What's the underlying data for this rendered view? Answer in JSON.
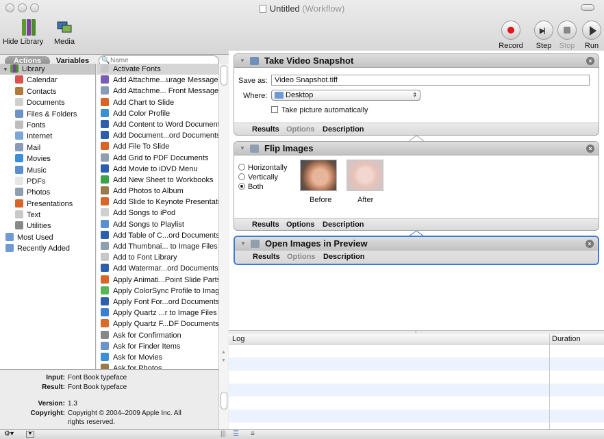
{
  "window": {
    "title": "Untitled",
    "subtitle": "(Workflow)"
  },
  "toolbar": {
    "hide_library": "Hide Library",
    "media": "Media",
    "record": "Record",
    "step": "Step",
    "stop": "Stop",
    "run": "Run"
  },
  "tabs": {
    "actions": "Actions",
    "variables": "Variables"
  },
  "search": {
    "placeholder": "Name"
  },
  "library": {
    "root": "Library",
    "items": [
      {
        "label": "Calendar",
        "icon": "calendar-icon",
        "color": "#d9534f"
      },
      {
        "label": "Contacts",
        "icon": "contacts-icon",
        "color": "#b07a3a"
      },
      {
        "label": "Documents",
        "icon": "documents-icon",
        "color": "#cfcfcf"
      },
      {
        "label": "Files & Folders",
        "icon": "folder-icon",
        "color": "#6b93c9"
      },
      {
        "label": "Fonts",
        "icon": "fonts-icon",
        "color": "#bdbdbd"
      },
      {
        "label": "Internet",
        "icon": "internet-icon",
        "color": "#7aa7d8"
      },
      {
        "label": "Mail",
        "icon": "mail-icon",
        "color": "#8a9bb8"
      },
      {
        "label": "Movies",
        "icon": "movies-icon",
        "color": "#3c8fd6"
      },
      {
        "label": "Music",
        "icon": "music-icon",
        "color": "#5a8fd0"
      },
      {
        "label": "PDFs",
        "icon": "pdf-icon",
        "color": "#e6e6e6"
      },
      {
        "label": "Photos",
        "icon": "photos-icon",
        "color": "#8f9fb0"
      },
      {
        "label": "Presentations",
        "icon": "presentations-icon",
        "color": "#d9642a"
      },
      {
        "label": "Text",
        "icon": "text-icon",
        "color": "#c9c9c9"
      },
      {
        "label": "Utilities",
        "icon": "utilities-icon",
        "color": "#888888"
      }
    ],
    "groups": [
      {
        "label": "Most Used",
        "icon": "most-used-folder-icon",
        "color": "#6f9ad3"
      },
      {
        "label": "Recently Added",
        "icon": "recently-added-folder-icon",
        "color": "#6f9ad3"
      }
    ]
  },
  "actions": [
    {
      "label": "Activate Fonts",
      "color": "#c7c7c7"
    },
    {
      "label": "Add Attachme...urage Messages",
      "color": "#7a5db5"
    },
    {
      "label": "Add Attachme... Front Message",
      "color": "#8a9bb8"
    },
    {
      "label": "Add Chart to Slide",
      "color": "#d9642a"
    },
    {
      "label": "Add Color Profile",
      "color": "#3c8fd6"
    },
    {
      "label": "Add Content to Word Documents",
      "color": "#2f5fa8"
    },
    {
      "label": "Add Document...ord Documents",
      "color": "#2f5fa8"
    },
    {
      "label": "Add File To Slide",
      "color": "#d9642a"
    },
    {
      "label": "Add Grid to PDF Documents",
      "color": "#8f9fb0"
    },
    {
      "label": "Add Movie to iDVD Menu",
      "color": "#2a5faf"
    },
    {
      "label": "Add New Sheet to Workbooks",
      "color": "#3aa34a"
    },
    {
      "label": "Add Photos to Album",
      "color": "#9a7a4a"
    },
    {
      "label": "Add Slide to Keynote Presentation",
      "color": "#d9642a"
    },
    {
      "label": "Add Songs to iPod",
      "color": "#d0d0d0"
    },
    {
      "label": "Add Songs to Playlist",
      "color": "#5a8fd0"
    },
    {
      "label": "Add Table of C...ord Documents",
      "color": "#2f5fa8"
    },
    {
      "label": "Add Thumbnai... to Image Files",
      "color": "#8f9fb0"
    },
    {
      "label": "Add to Font Library",
      "color": "#c7c7c7"
    },
    {
      "label": "Add Watermar...ord Documents",
      "color": "#2f5fa8"
    },
    {
      "label": "Apply Animati...Point Slide Parts",
      "color": "#d9642a"
    },
    {
      "label": "Apply ColorSync Profile to Images",
      "color": "#5ab55a"
    },
    {
      "label": "Apply Font For...ord Documents",
      "color": "#2f5fa8"
    },
    {
      "label": "Apply Quartz ...r to Image Files",
      "color": "#3c7fd0"
    },
    {
      "label": "Apply Quartz F...DF Documents",
      "color": "#d96a2a"
    },
    {
      "label": "Ask for Confirmation",
      "color": "#888888"
    },
    {
      "label": "Ask for Finder Items",
      "color": "#6b93c9"
    },
    {
      "label": "Ask for Movies",
      "color": "#3c8fd6"
    },
    {
      "label": "Ask for Photos",
      "color": "#9a7a4a"
    }
  ],
  "info": {
    "input_label": "Input:",
    "input_value": "Font Book typeface",
    "result_label": "Result:",
    "result_value": "Font Book typeface",
    "version_label": "Version:",
    "version_value": "1.3",
    "copyright_label": "Copyright:",
    "copyright_value_1": "Copyright © 2004–2009 Apple Inc. All",
    "copyright_value_2": "rights reserved."
  },
  "workflow": {
    "snapshot": {
      "title": "Take Video Snapshot",
      "save_as_label": "Save as:",
      "save_as_value": "Video Snapshot.tiff",
      "where_label": "Where:",
      "where_value": "Desktop",
      "auto_label": "Take picture automatically",
      "footer": {
        "results": "Results",
        "options": "Options",
        "description": "Description"
      }
    },
    "flip": {
      "title": "Flip Images",
      "horizontally": "Horizontally",
      "vertically": "Vertically",
      "both": "Both",
      "selected": "Both",
      "before": "Before",
      "after": "After",
      "footer": {
        "results": "Results",
        "options": "Options",
        "description": "Description"
      }
    },
    "preview": {
      "title": "Open Images in Preview",
      "footer": {
        "results": "Results",
        "options": "Options",
        "description": "Description"
      }
    }
  },
  "log": {
    "col_log": "Log",
    "col_duration": "Duration"
  }
}
